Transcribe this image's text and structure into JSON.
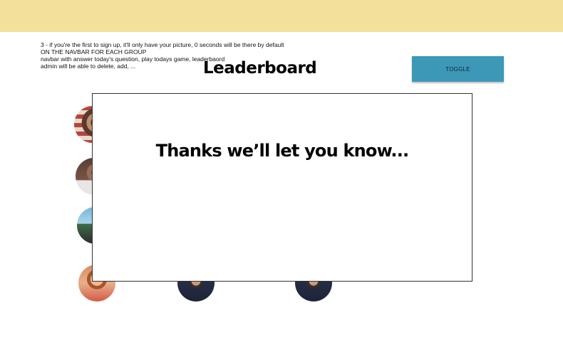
{
  "colors": {
    "topbar": "#f3e09b",
    "toggle_button": "#3d98b8",
    "modal_border": "#333333"
  },
  "notes": [
    "3 - if you're the first to sign up, it'll only have your picture, 0 seconds will be there by default",
    "ON THE NAVBAR FOR EACH GROUP",
    "navbar with answer today's question, play todays game, leaderbaord",
    "admin will be able to delete, add, ..."
  ],
  "page": {
    "title": "Leaderboard",
    "toggle_label": "TOGGLE"
  },
  "modal": {
    "message": "Thanks we’ll let you know..."
  },
  "avatars": [
    {
      "icon": "avatar-photo"
    },
    {
      "icon": "avatar-photo"
    },
    {
      "icon": "avatar-photo"
    },
    {
      "icon": "avatar-photo"
    },
    {
      "icon": "avatar-photo"
    },
    {
      "icon": "avatar-photo"
    }
  ]
}
